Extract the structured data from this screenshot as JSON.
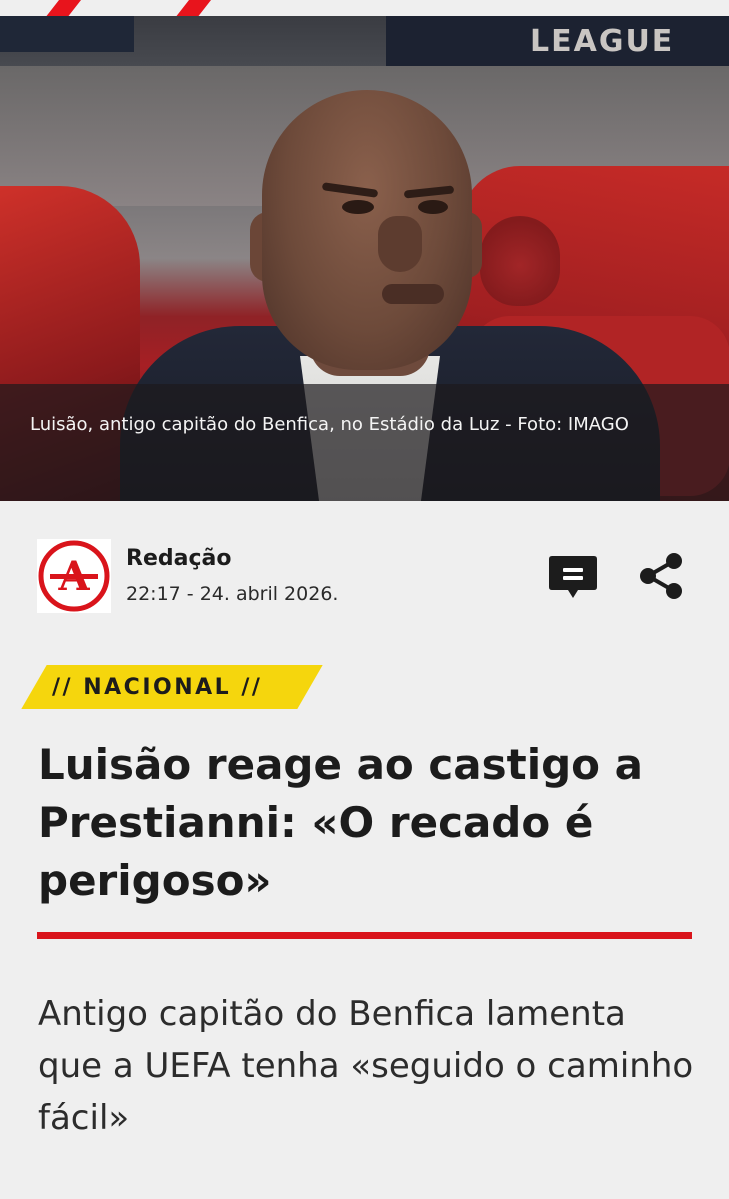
{
  "hero": {
    "background_text": "LEAGUE",
    "caption": "Luisão, antigo capitão do Benfica, no Estádio da Luz - Foto: IMAGO"
  },
  "author": {
    "logo_letter": "A",
    "name": "Redação",
    "datetime": "22:17 - 24. abril 2026."
  },
  "actions": {
    "comment_icon": "comment-icon",
    "share_icon": "share-icon"
  },
  "article": {
    "category": "// NACIONAL //",
    "headline": "Luisão reage ao castigo a Prestianni: «O recado é perigoso»",
    "lead": "Antigo capitão do Benfica lamenta que a UEFA tenha «seguido o caminho fácil»"
  },
  "colors": {
    "accent_red": "#d9141b",
    "tag_yellow": "#f5d60d",
    "background": "#efefef",
    "text": "#1c1c1c"
  }
}
